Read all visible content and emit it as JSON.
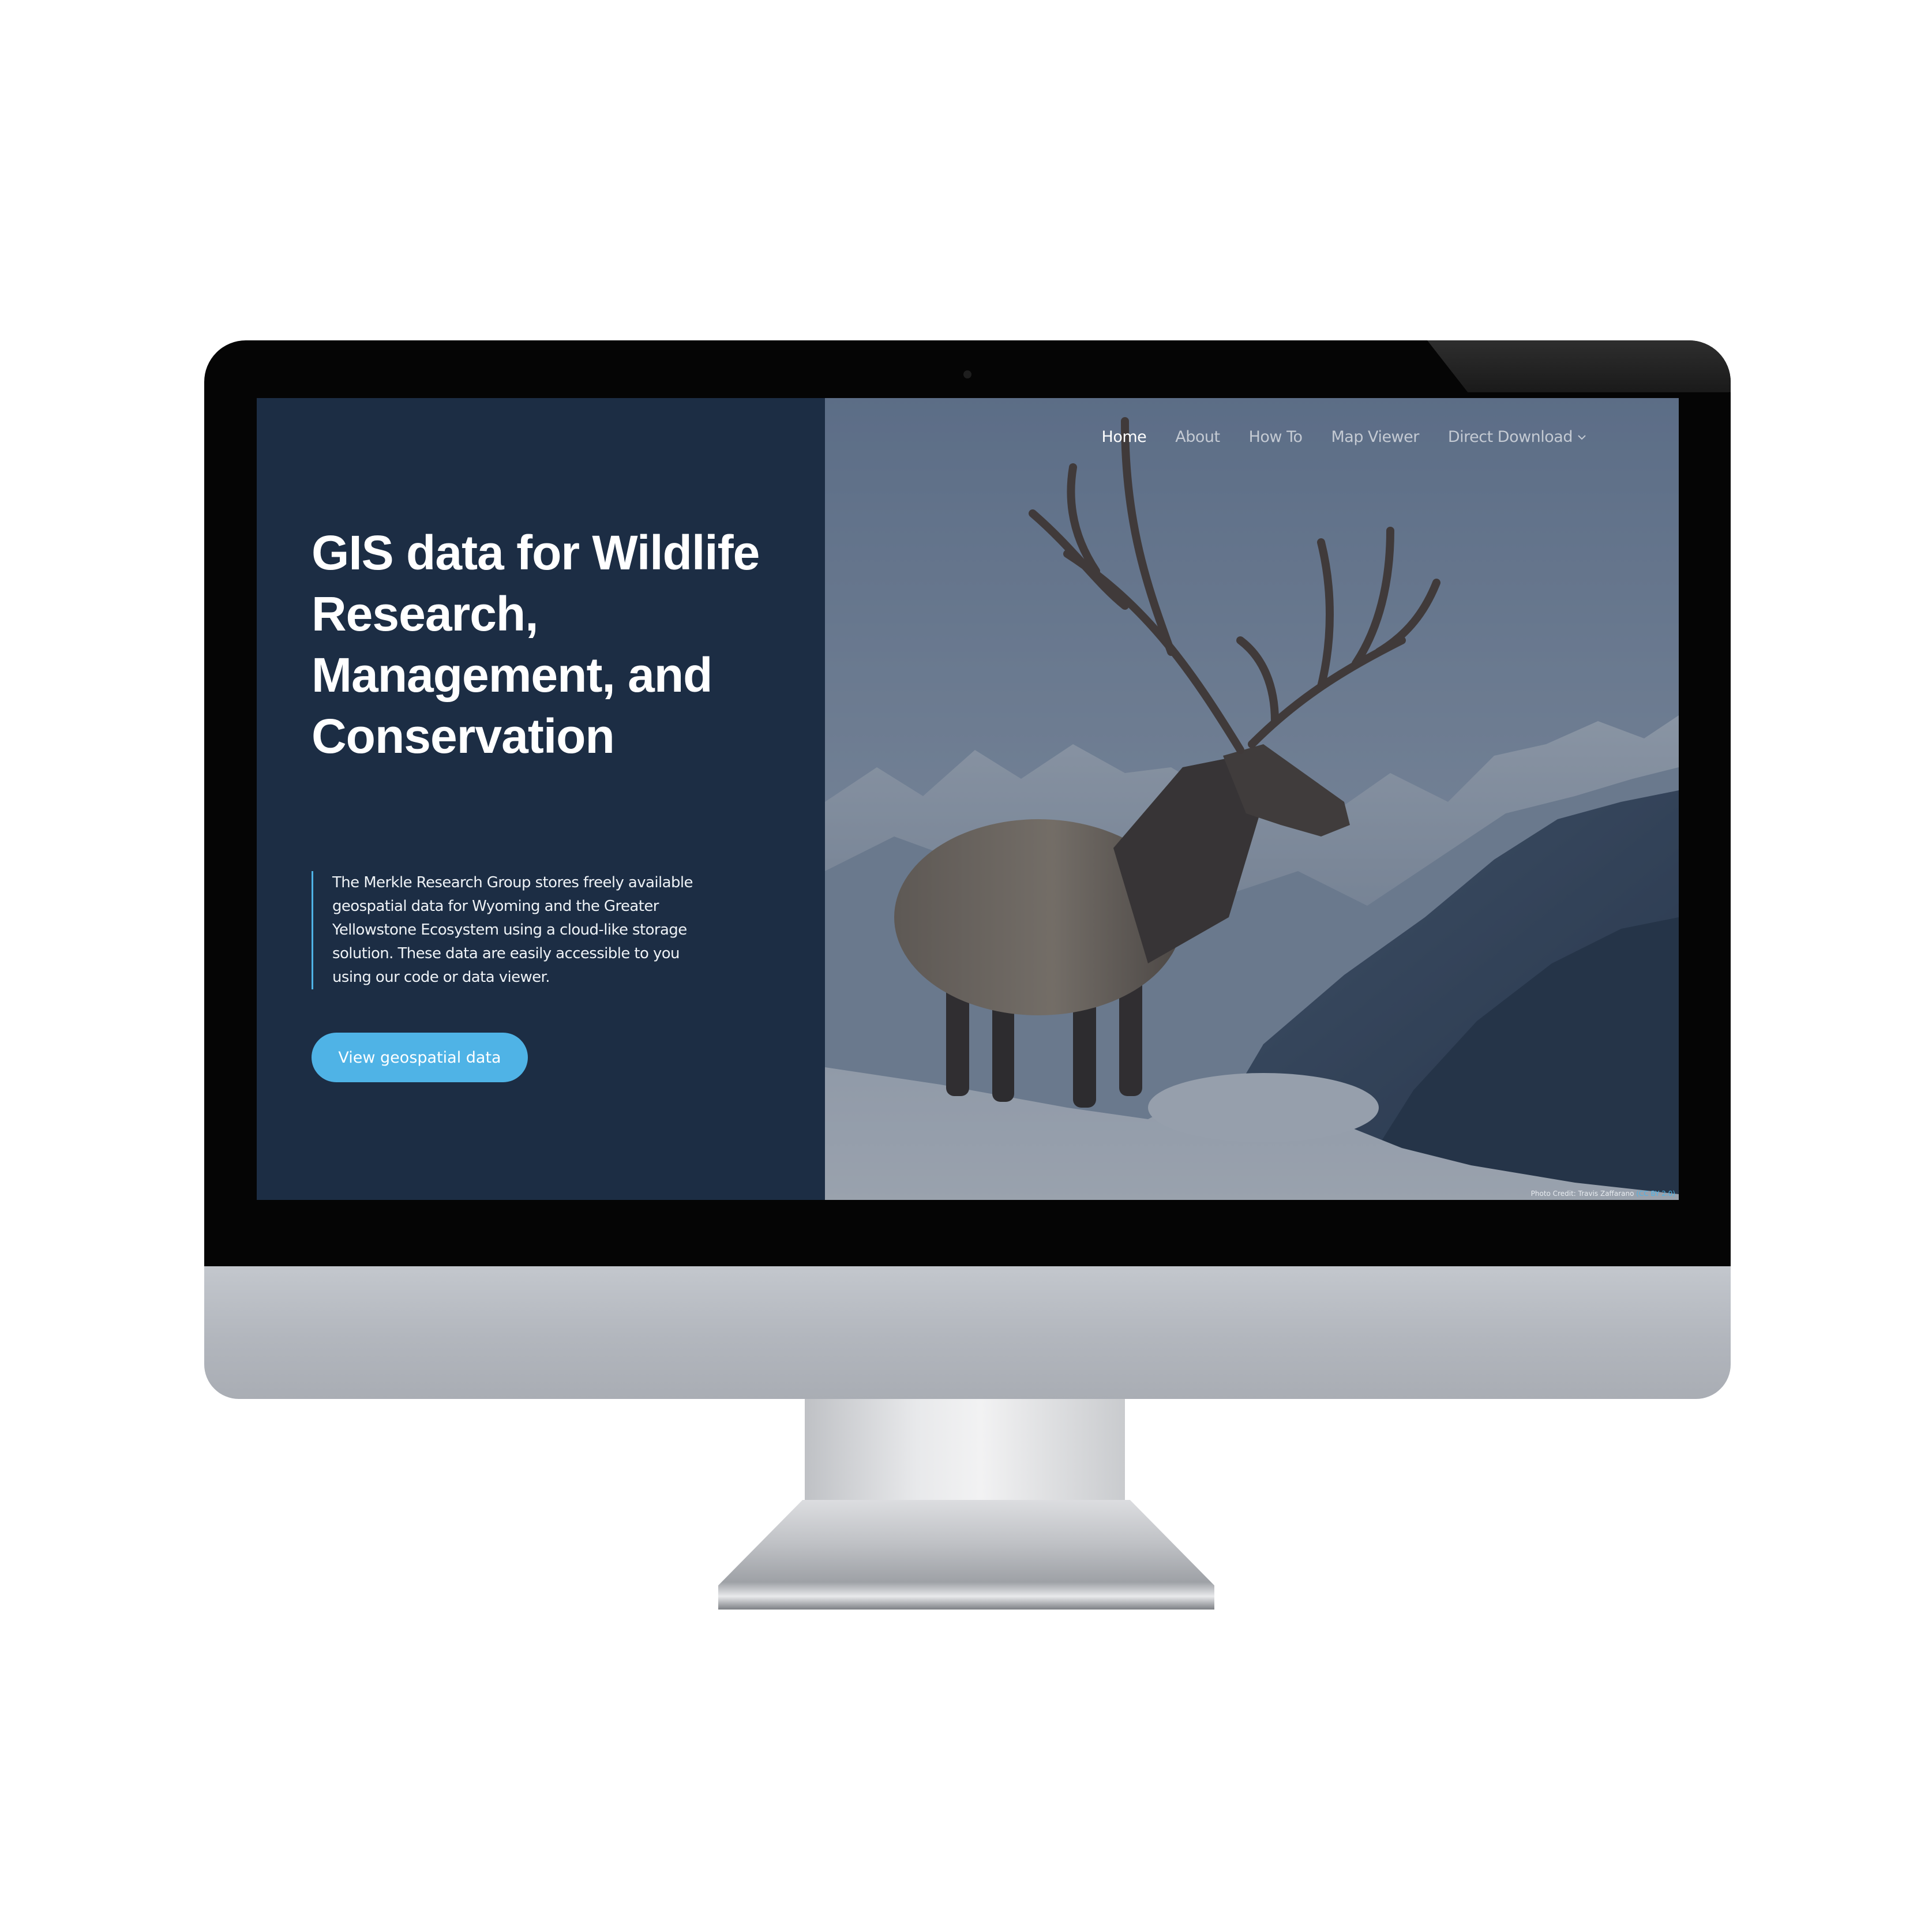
{
  "nav": {
    "items": [
      {
        "label": "Home",
        "active": true
      },
      {
        "label": "About",
        "active": false
      },
      {
        "label": "How To",
        "active": false
      },
      {
        "label": "Map Viewer",
        "active": false
      },
      {
        "label": "Direct Download",
        "active": false,
        "icon": "chevron-down-icon"
      }
    ]
  },
  "hero": {
    "title": "GIS data for Wildlife Research, Management, and Conservation",
    "description": "The Merkle Research Group stores freely available geospatial data for Wyoming and the Greater Yellowstone Ecosystem using a cloud-like storage solution. These data are easily accessible to you using our code or data viewer.",
    "button_label": "View geospatial data"
  },
  "credit": {
    "text": "Photo Credit: Travis Zaffarano",
    "license": "(CC BY 2.0)"
  },
  "colors": {
    "panel": "#1c2d44",
    "accent": "#4fb3e6",
    "text": "#ffffff"
  }
}
